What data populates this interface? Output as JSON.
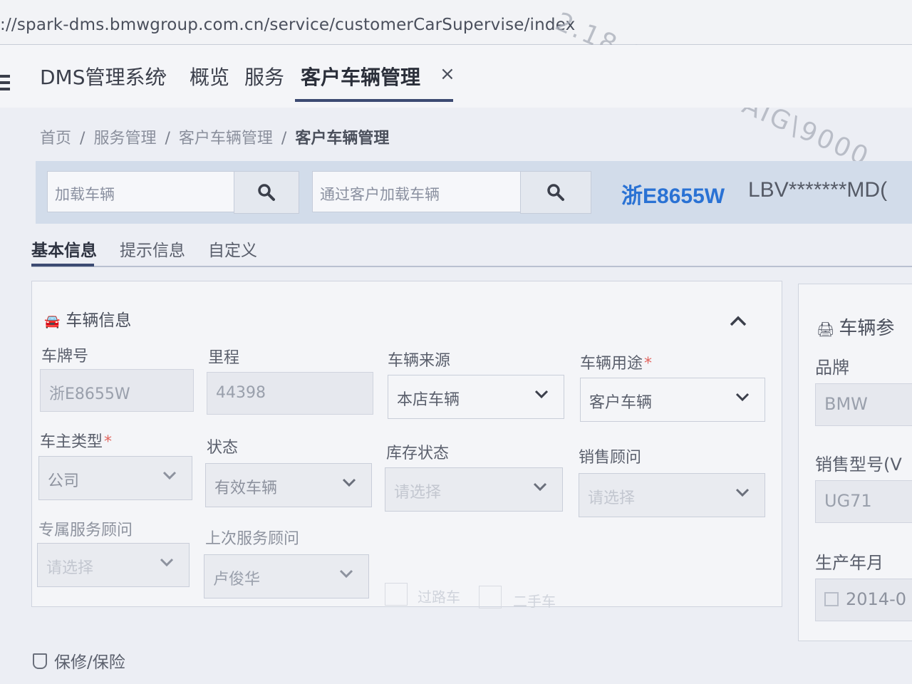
{
  "browser": {
    "url": "://spark-dms.bmwgroup.com.cn/service/customerCarSupervise/index",
    "watermark": "2.18.60.155 PAIG\\9000"
  },
  "nav": {
    "system": "DMS管理系统",
    "items": [
      "概览",
      "服务"
    ],
    "active_tab": "客户车辆管理",
    "close_glyph": "×"
  },
  "breadcrumb": [
    "首页",
    "服务管理",
    "客户车辆管理",
    "客户车辆管理"
  ],
  "search": {
    "vehicle_placeholder": "加载车辆",
    "customer_placeholder": "通过客户加载车辆",
    "plate": "浙E8655W",
    "vin": "LBV*******MD("
  },
  "tabs": [
    "基本信息",
    "提示信息",
    "自定义"
  ],
  "vehicle_info": {
    "title": "车辆信息",
    "fields": {
      "plate_label": "车牌号",
      "plate_value": "浙E8655W",
      "mileage_label": "里程",
      "mileage_value": "44398",
      "source_label": "车辆来源",
      "source_value": "本店车辆",
      "usage_label": "车辆用途",
      "usage_value": "客户车辆",
      "owner_type_label": "车主类型",
      "owner_type_value": "公司",
      "status_label": "状态",
      "status_value": "有效车辆",
      "stock_label": "库存状态",
      "stock_placeholder": "请选择",
      "sales_advisor_label": "销售顾问",
      "sales_advisor_placeholder": "请选择",
      "exclusive_advisor_label": "专属服务顾问",
      "exclusive_advisor_placeholder": "请选择",
      "last_advisor_label": "上次服务顾问",
      "last_advisor_value": "卢俊华",
      "transit_label": "过路车",
      "other_faint": "二手车"
    }
  },
  "vehicle_params": {
    "title": "车辆参",
    "brand_label": "品牌",
    "brand_value": "BMW",
    "model_label": "销售型号(V",
    "model_value": "UG71",
    "date_label": "生产年月",
    "date_value": "2014-0"
  },
  "warranty": {
    "title": "保修/保险"
  },
  "colors": {
    "accent": "#2a72d4",
    "required": "#e2655f",
    "nav_underline": "#3c4a72"
  },
  "icons": [
    "menu-icon",
    "search-icon",
    "car-icon",
    "chevron-up-icon",
    "chevron-down-icon",
    "calendar-icon",
    "shield-icon"
  ]
}
